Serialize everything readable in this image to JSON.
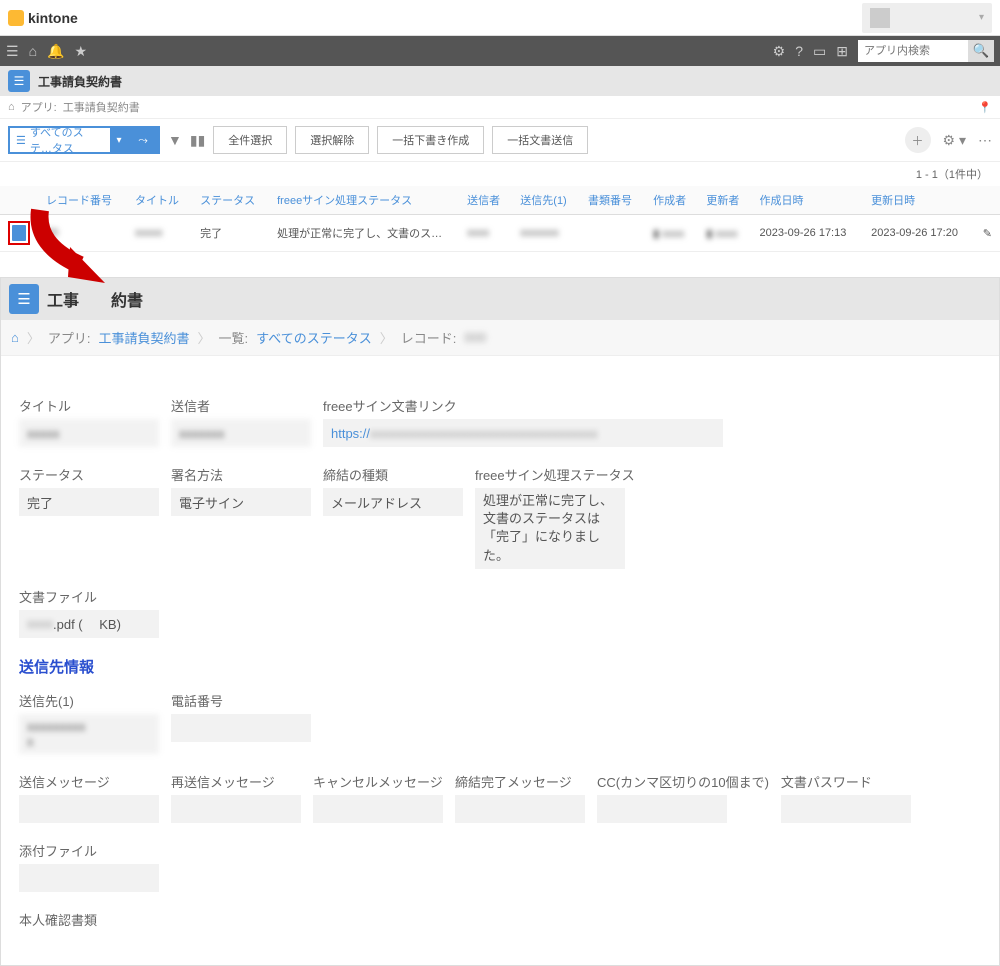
{
  "brand": "kintone",
  "search_placeholder": "アプリ内検索",
  "app": {
    "title": "工事請負契約書"
  },
  "breadcrumb": {
    "app_prefix": "アプリ:",
    "app_name": "工事請負契約書"
  },
  "toolbar": {
    "view_label": "すべてのステ…タス",
    "btn_select_all": "全件選択",
    "btn_deselect": "選択解除",
    "btn_draft": "一括下書き作成",
    "btn_send": "一括文書送信"
  },
  "pager": "1 - 1（1件中）",
  "columns": {
    "record_no": "レコード番号",
    "title": "タイトル",
    "status": "ステータス",
    "freee_status": "freeeサイン処理ステータス",
    "sender": "送信者",
    "dest1": "送信先(1)",
    "doc_no": "書類番号",
    "creator": "作成者",
    "updater": "更新者",
    "created_at": "作成日時",
    "updated_at": "更新日時"
  },
  "row": {
    "status": "完了",
    "freee_status": "処理が正常に完了し、文書のステータスは「完了」になりま…",
    "created_at": "2023-09-26 17:13",
    "updated_at": "2023-09-26 17:20"
  },
  "detail": {
    "bc_app_prefix": "アプリ:",
    "bc_app": "工事請負契約書",
    "bc_list_prefix": "一覧:",
    "bc_list": "すべてのステータス",
    "bc_record": "レコード:",
    "labels": {
      "title": "タイトル",
      "sender": "送信者",
      "freee_link": "freeeサイン文書リンク",
      "status": "ステータス",
      "sign_method": "署名方法",
      "contract_type": "締結の種類",
      "freee_status": "freeeサイン処理ステータス",
      "doc_file": "文書ファイル",
      "dest_section": "送信先情報",
      "dest1": "送信先(1)",
      "phone": "電話番号",
      "send_msg": "送信メッセージ",
      "resend_msg": "再送信メッセージ",
      "cancel_msg": "キャンセルメッセージ",
      "complete_msg": "締結完了メッセージ",
      "cc": "CC(カンマ区切りの10個まで)",
      "doc_pw": "文書パスワード",
      "attachment": "添付ファイル",
      "identity": "本人確認書類"
    },
    "values": {
      "link_prefix": "https://",
      "status": "完了",
      "sign_method": "電子サイン",
      "contract_type": "メールアドレス",
      "freee_status": "処理が正常に完了し、文書のステータスは「完了」になりました。",
      "doc_file_suffix": ".pdf (　 KB)"
    }
  }
}
